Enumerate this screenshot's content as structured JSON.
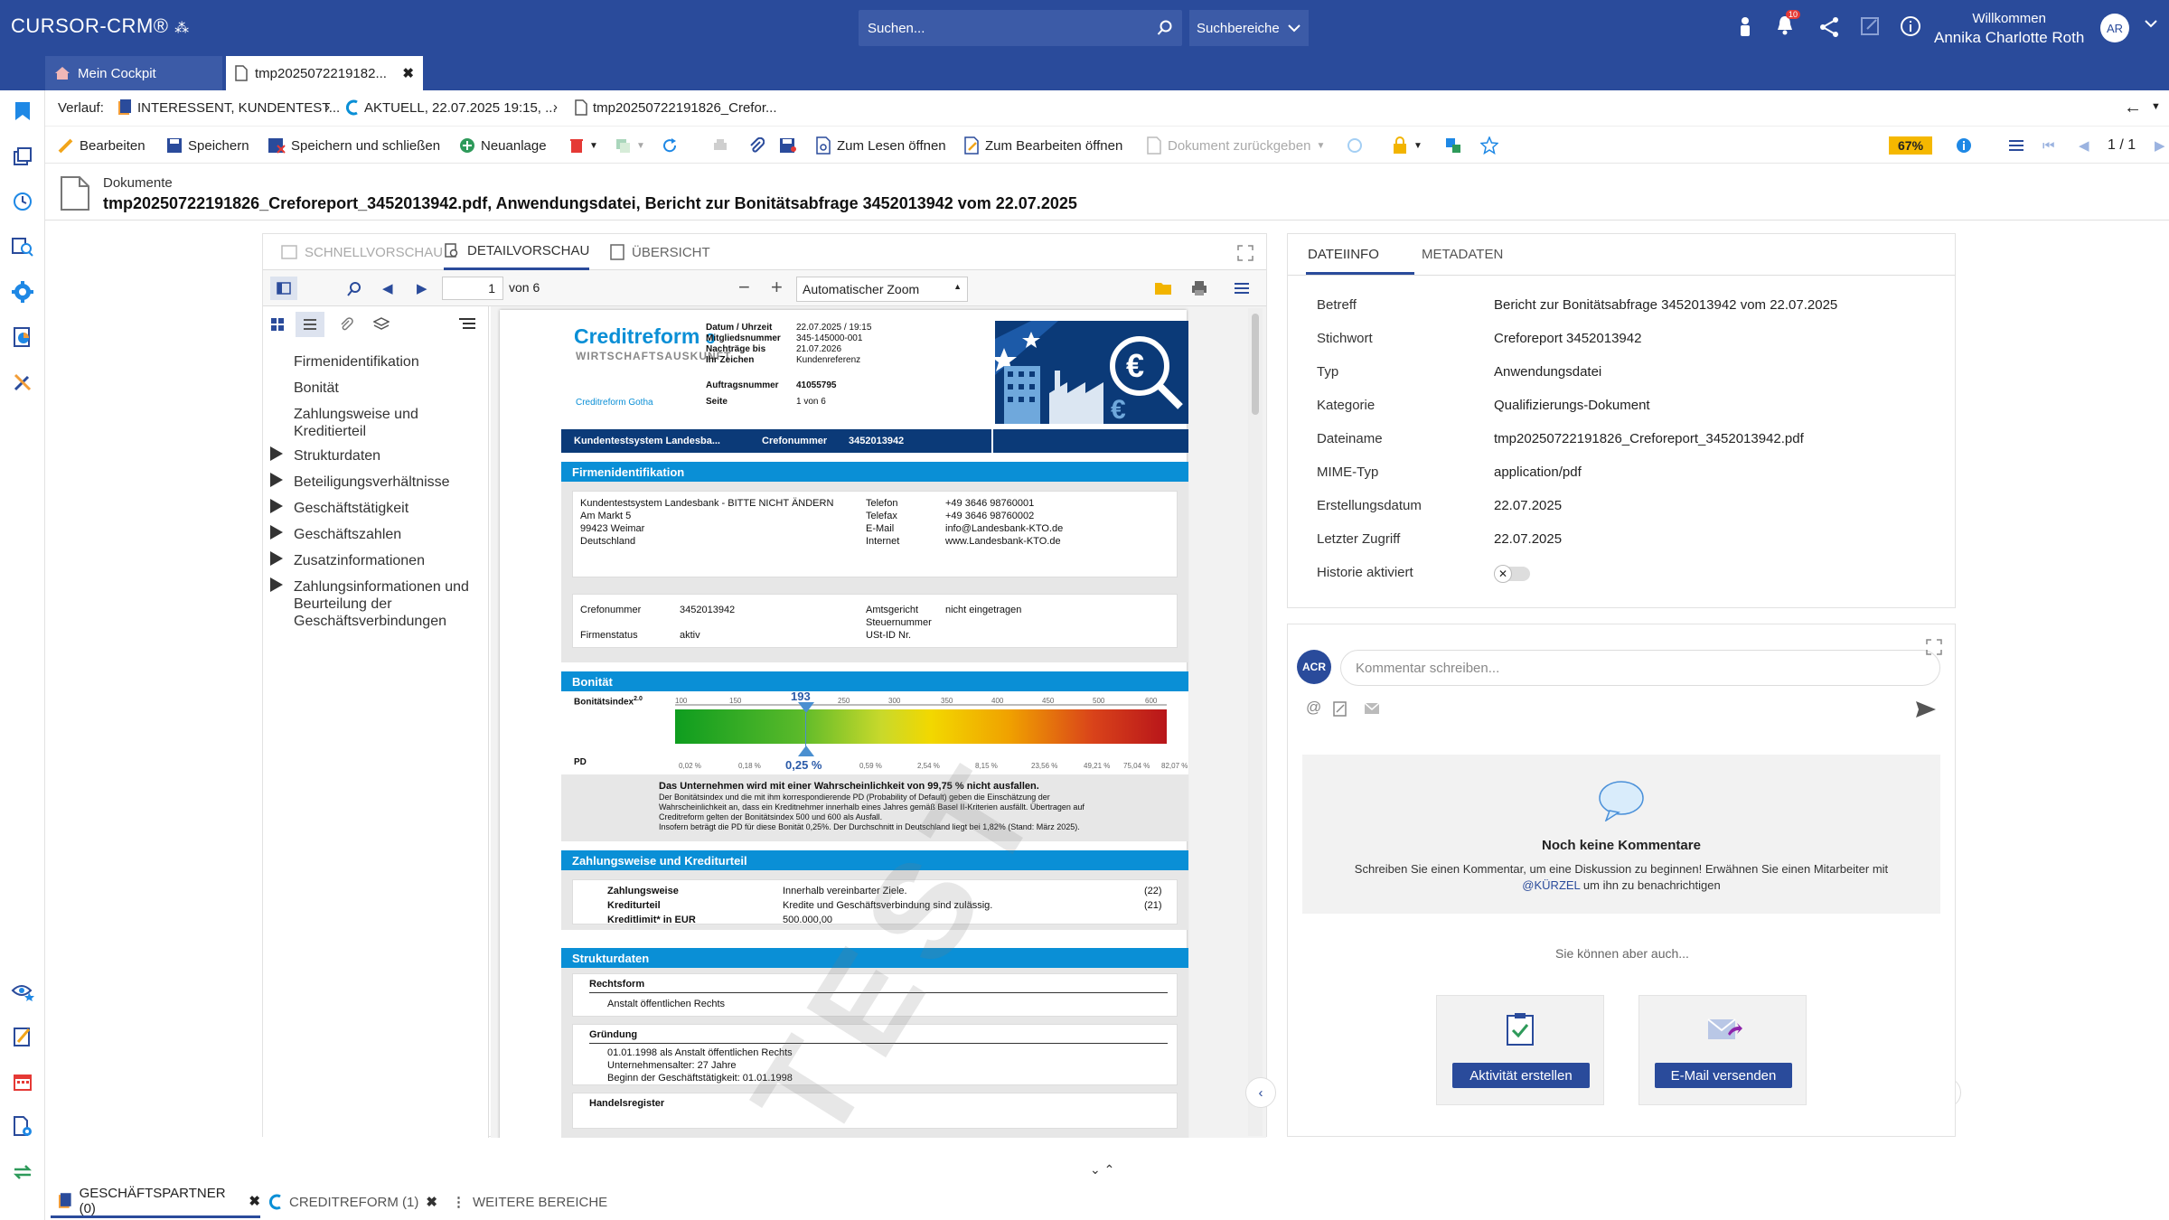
{
  "app": {
    "logo": "CURSOR-CRM®"
  },
  "header": {
    "search_placeholder": "Suchen...",
    "search_scope": "Suchbereiche",
    "notification_count": "10",
    "welcome": "Willkommen",
    "user_name": "Annika Charlotte Roth",
    "user_initials": "AR"
  },
  "window_tabs": [
    {
      "label": "Mein Cockpit"
    },
    {
      "label": "tmp2025072219182..."
    }
  ],
  "breadcrumb": {
    "label": "Verlauf:",
    "items": [
      "INTERESSENT, KUNDENTEST...",
      "AKTUELL, 22.07.2025 19:15, ...",
      "tmp20250722191826_Crefor..."
    ]
  },
  "toolbar": {
    "edit": "Bearbeiten",
    "save": "Speichern",
    "save_close": "Speichern und schließen",
    "new": "Neuanlage",
    "open_read": "Zum Lesen öffnen",
    "open_edit": "Zum Bearbeiten öffnen",
    "return_doc": "Dokument zurückgeben",
    "percent": "67%",
    "paging": "1 / 1"
  },
  "document": {
    "category": "Dokumente",
    "title": "tmp20250722191826_Creforeport_3452013942.pdf, Anwendungsdatei, Bericht zur Bonitätsabfrage 3452013942 vom 22.07.2025"
  },
  "viewer": {
    "tabs": [
      "SCHNELLVORSCHAU",
      "DETAILVORSCHAU",
      "ÜBERSICHT"
    ],
    "page_input": "1",
    "page_of": "von 6",
    "zoom": "Automatischer Zoom",
    "outline": [
      "Firmenidentifikation",
      "Bonität",
      "Zahlungsweise und Kreditierteil",
      "Strukturdaten",
      "Beteiligungsverhältnisse",
      "Geschäftstätigkeit",
      "Geschäftszahlen",
      "Zusatzinformationen",
      "Zahlungsinformationen und Beurteilung der Geschäftsverbindungen"
    ]
  },
  "pdf": {
    "brand": "Creditreform",
    "subbrand": "WIRTSCHAFTSAUSKUNFT",
    "office": "Creditreform Gotha",
    "meta_labels": [
      "Datum / Uhrzeit",
      "Mitgliedsnummer",
      "Nachträge bis",
      "Ihr Zeichen",
      "Auftragsnummer",
      "Seite"
    ],
    "meta_values": [
      "22.07.2025 / 19:15",
      "345-145000-001",
      "21.07.2026",
      "Kundenreferenz",
      "41055795",
      "1 von 6"
    ],
    "navy_left": "Kundentestsystem Landesba...",
    "navy_crefo_label": "Crefonummer",
    "navy_crefo_value": "3452013942",
    "sec_firm": "Firmenidentifikation",
    "firm_name": "Kundentestsystem Landesbank - BITTE NICHT ÄNDERN",
    "firm_street": "Am Markt 5",
    "firm_city": "99423 Weimar",
    "firm_country": "Deutschland",
    "contact_labels": [
      "Telefon",
      "Telefax",
      "E-Mail",
      "Internet"
    ],
    "contact_values": [
      "+49 3646 98760001",
      "+49 3646 98760002",
      "info@Landesbank-KTO.de",
      "www.Landesbank-KTO.de"
    ],
    "crefo_label": "Crefonummer",
    "crefo_value": "3452013942",
    "status_label": "Firmenstatus",
    "status_value": "aktiv",
    "court_labels": [
      "Amtsgericht",
      "Steuernummer",
      "USt-ID Nr."
    ],
    "court_value": "nicht eingetragen",
    "sec_bon": "Bonität",
    "bon_index_label": "Bonitätsindex",
    "bon_index_sup": "2.0",
    "bon_scale": [
      "100",
      "150",
      "193",
      "250",
      "300",
      "350",
      "400",
      "450",
      "500",
      "600"
    ],
    "bon_value": "193",
    "pd_label": "PD",
    "pd_scale": [
      "0,02 %",
      "0,18 %",
      "0,59 %",
      "2,54 %",
      "8,15 %",
      "23,56 %",
      "49,21 %",
      "75,04 %",
      "82,07 %"
    ],
    "pd_value": "0,25 %",
    "bon_text_bold": "Das Unternehmen wird mit einer Wahrscheinlichkeit von 99,75 % nicht ausfallen.",
    "bon_text": [
      "Der Bonitätsindex und die mit ihm korrespondierende PD (Probability of Default) geben die Einschätzung der",
      "Wahrscheinlichkeit an, dass ein Kreditnehmer innerhalb eines Jahres gemäß Basel II-Kriterien ausfällt. Übertragen auf",
      "Creditreform gelten der Bonitätsindex 500 und 600 als Ausfall.",
      "Insofern beträgt die PD für diese Bonität 0,25%. Der Durchschnitt in Deutschland liegt bei 1,82% (Stand: März 2025)."
    ],
    "sec_pay": "Zahlungsweise und Krediturteil",
    "pay_rows": [
      {
        "label": "Zahlungsweise",
        "value": "Innerhalb vereinbarter Ziele.",
        "code": "(22)"
      },
      {
        "label": "Krediturteil",
        "value": "Kredite und Geschäftsverbindung sind zulässig.",
        "code": "(21)"
      },
      {
        "label": "Kreditlimit* in EUR",
        "value": "500.000,00",
        "code": ""
      }
    ],
    "sec_struct": "Strukturdaten",
    "legal_form_label": "Rechtsform",
    "legal_form_value": "Anstalt öffentlichen Rechts",
    "founding_label": "Gründung",
    "founding_lines": [
      "01.01.1998 als Anstalt öffentlichen Rechts",
      "Unternehmensalter: 27 Jahre",
      "Beginn der Geschäftstätigkeit: 01.01.1998"
    ],
    "register_label": "Handelsregister",
    "watermark": "TEST"
  },
  "info": {
    "tabs": [
      "DATEIINFO",
      "METADATEN"
    ],
    "rows": [
      {
        "label": "Betreff",
        "value": "Bericht zur Bonitätsabfrage 3452013942 vom 22.07.2025"
      },
      {
        "label": "Stichwort",
        "value": "Creforeport 3452013942"
      },
      {
        "label": "Typ",
        "value": "Anwendungsdatei"
      },
      {
        "label": "Kategorie",
        "value": "Qualifizierungs-Dokument"
      },
      {
        "label": "Dateiname",
        "value": "tmp20250722191826_Creforeport_3452013942.pdf"
      },
      {
        "label": "MIME-Typ",
        "value": "application/pdf"
      },
      {
        "label": "Erstellungsdatum",
        "value": "22.07.2025"
      },
      {
        "label": "Letzter Zugriff",
        "value": "22.07.2025"
      },
      {
        "label": "Historie aktiviert",
        "value": ""
      }
    ]
  },
  "comments": {
    "avatar": "ACR",
    "placeholder": "Kommentar schreiben...",
    "empty_title": "Noch keine Kommentare",
    "empty_text": "Schreiben Sie einen Kommentar, um eine Diskussion zu beginnen! Erwähnen Sie einen Mitarbeiter mit",
    "empty_mention": "@KÜRZEL",
    "empty_text2": " um ihn zu benachrichtigen",
    "also": "Sie können aber auch...",
    "action1": "Aktivität erstellen",
    "action2": "E-Mail versenden"
  },
  "bottom_tabs": [
    {
      "label": "GESCHÄFTSPARTNER (0)"
    },
    {
      "label": "CREDITREFORM (1)"
    },
    {
      "label": "WEITERE BEREICHE"
    }
  ],
  "colors": {
    "brand": "#2a4b9b",
    "crefo_blue": "#0a8fd6",
    "navy": "#0b3a78",
    "badge": "#f5b800"
  }
}
